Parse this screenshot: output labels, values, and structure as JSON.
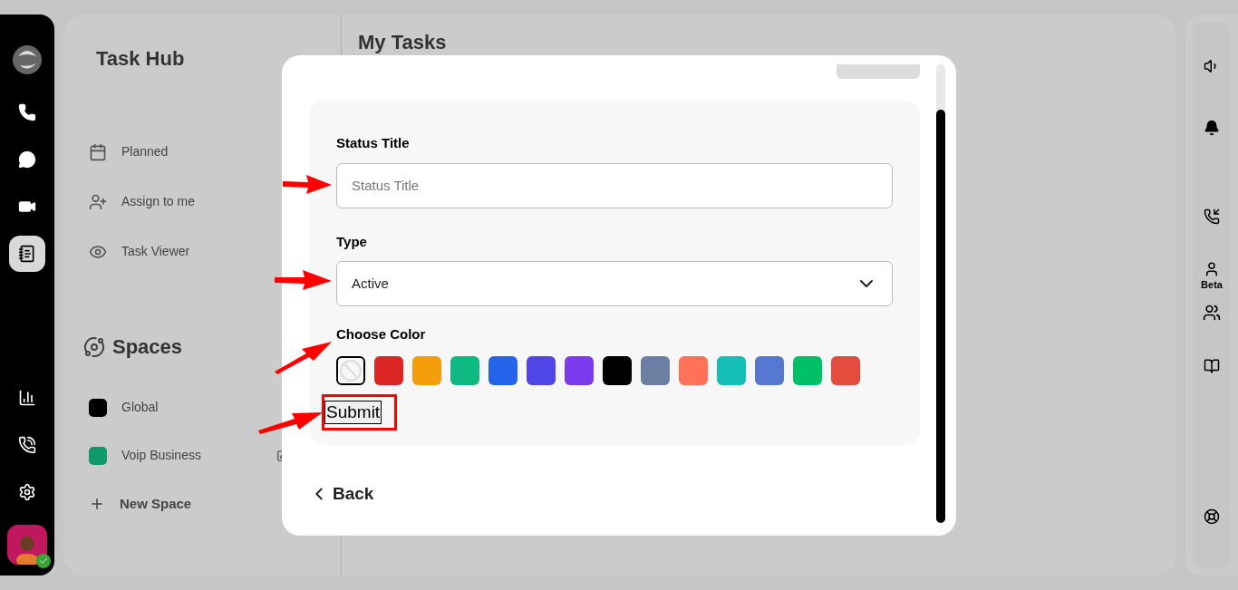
{
  "rail": {
    "items": [
      {
        "kind": "phone",
        "selected": false
      },
      {
        "kind": "chat",
        "selected": false
      },
      {
        "kind": "video",
        "selected": false
      },
      {
        "kind": "notes",
        "selected": true
      },
      {
        "kind": "stats",
        "selected": false
      },
      {
        "kind": "calls",
        "selected": false
      },
      {
        "kind": "settings",
        "selected": false
      }
    ],
    "status_online": true
  },
  "task_hub": {
    "title": "Task Hub",
    "nav": [
      {
        "kind": "calendar",
        "label": "Planned"
      },
      {
        "kind": "assign",
        "label": "Assign to me"
      },
      {
        "kind": "eye",
        "label": "Task Viewer"
      }
    ],
    "spaces_title": "Spaces",
    "spaces": [
      {
        "label": "Global",
        "color": "#000000",
        "editable": false
      },
      {
        "label": "Voip Business",
        "color": "#0f9a6a",
        "editable": true
      }
    ],
    "new_space": "New Space"
  },
  "main": {
    "title": "My Tasks"
  },
  "modal": {
    "fields": [
      {
        "kind": "text",
        "label": "Status Title",
        "placeholder": "Status Title"
      },
      {
        "kind": "select",
        "label": "Type",
        "value": "Active"
      }
    ],
    "color_label": "Choose Color",
    "colors": [
      {
        "kind": "none",
        "selected": true
      },
      {
        "color": "#dc2626",
        "selected": false
      },
      {
        "color": "#f59e0b",
        "selected": false
      },
      {
        "color": "#10b981",
        "selected": false
      },
      {
        "color": "#2563eb",
        "selected": false
      },
      {
        "color": "#4f46e5",
        "selected": false
      },
      {
        "color": "#7c3aed",
        "selected": false
      },
      {
        "color": "#000000",
        "selected": false
      },
      {
        "color": "#6b7fa3",
        "selected": false
      },
      {
        "color": "#ff7259",
        "selected": false
      },
      {
        "color": "#14bfb8",
        "selected": false
      },
      {
        "color": "#5577d0",
        "selected": false
      },
      {
        "color": "#00c065",
        "selected": false
      },
      {
        "color": "#e34c3c",
        "selected": false
      }
    ],
    "submit": "Submit",
    "back": "Back"
  },
  "right_rail": {
    "beta": "Beta"
  }
}
